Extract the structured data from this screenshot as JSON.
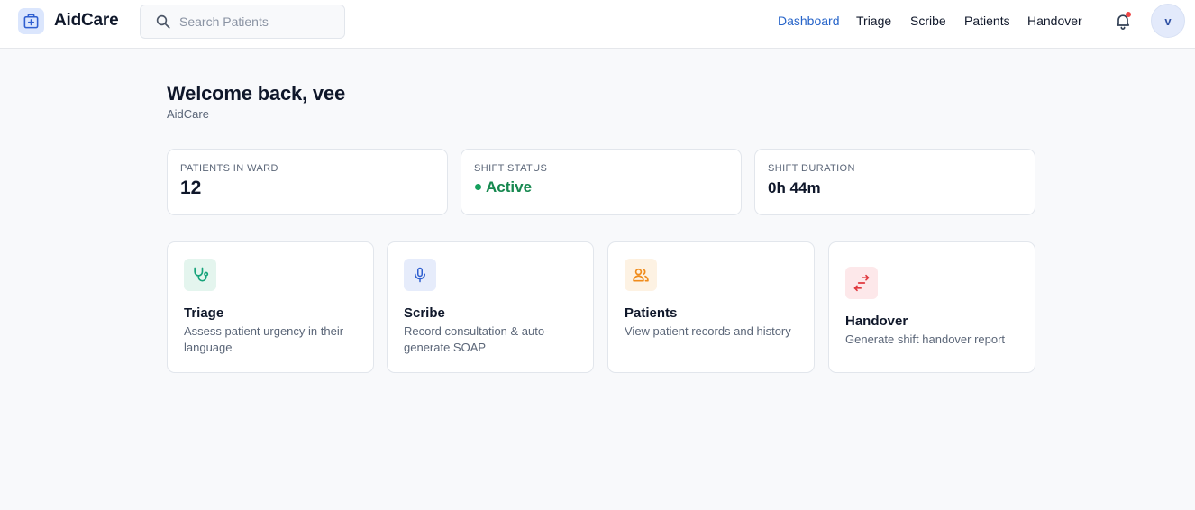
{
  "app": {
    "name": "AidCare",
    "icon": "medical-kit-icon",
    "accent": "#2563c9"
  },
  "search": {
    "placeholder": "Search Patients",
    "value": ""
  },
  "nav": {
    "items": [
      {
        "label": "Dashboard",
        "active": true
      },
      {
        "label": "Triage",
        "active": false
      },
      {
        "label": "Scribe",
        "active": false
      },
      {
        "label": "Patients",
        "active": false
      },
      {
        "label": "Handover",
        "active": false
      }
    ]
  },
  "notifications": {
    "icon": "bell-icon",
    "has_unread": true
  },
  "user": {
    "initial": "v"
  },
  "header": {
    "welcome": "Welcome back, vee",
    "subtitle": "AidCare"
  },
  "stats": [
    {
      "label": "PATIENTS IN WARD",
      "value": "12"
    },
    {
      "label": "SHIFT STATUS",
      "value": "Active",
      "color": "#16884f"
    },
    {
      "label": "SHIFT DURATION",
      "value": "0h 44m"
    }
  ],
  "cards": [
    {
      "title": "Triage",
      "description": "Assess patient urgency in their language",
      "icon": "stethoscope-icon",
      "icon_bg": "#e4f5ee",
      "icon_color": "#16a37a"
    },
    {
      "title": "Scribe",
      "description": "Record consultation & auto-generate SOAP",
      "icon": "microphone-icon",
      "icon_bg": "#e6ecfb",
      "icon_color": "#2f5fd0"
    },
    {
      "title": "Patients",
      "description": "View patient records and history",
      "icon": "users-icon",
      "icon_bg": "#fdf2e3",
      "icon_color": "#f08c1c"
    },
    {
      "title": "Handover",
      "description": "Generate shift handover report",
      "icon": "swap-arrows-icon",
      "icon_bg": "#fde8ea",
      "icon_color": "#e0393f"
    }
  ]
}
